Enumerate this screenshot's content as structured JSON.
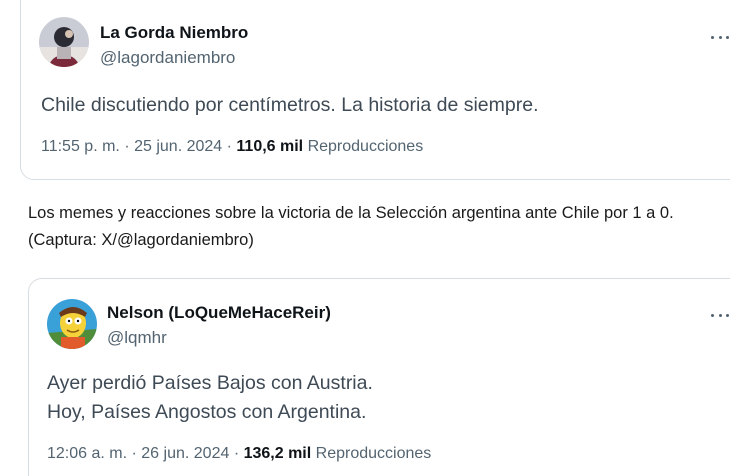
{
  "tweets": [
    {
      "display_name": "La Gorda Niembro",
      "handle": "@lagordaniembro",
      "lines": [
        "Chile discutiendo por centímetros. La historia de siempre."
      ],
      "time": "11:55 p. m.",
      "date": "25 jun. 2024",
      "views": "110,6 mil",
      "views_label": "Reproducciones"
    },
    {
      "display_name": "Nelson (LoQueMeHaceReir)",
      "handle": "@lqmhr",
      "lines": [
        "Ayer perdió Países Bajos con Austria.",
        "Hoy, Países Angostos con Argentina."
      ],
      "time": "12:06 a. m.",
      "date": "26 jun. 2024",
      "views": "136,2 mil",
      "views_label": "Reproducciones"
    }
  ],
  "meta_separator": "·",
  "caption": {
    "line1": "Los memes y reacciones sobre la victoria de la Selección argentina ante Chile por 1 a 0.",
    "line2": "(Captura: X/@lagordaniembro)"
  },
  "icons": {
    "more": "more-horizontal-icon"
  },
  "colors": {
    "text_primary": "#0f1419",
    "text_secondary": "#536471",
    "border": "#d8dde1"
  }
}
